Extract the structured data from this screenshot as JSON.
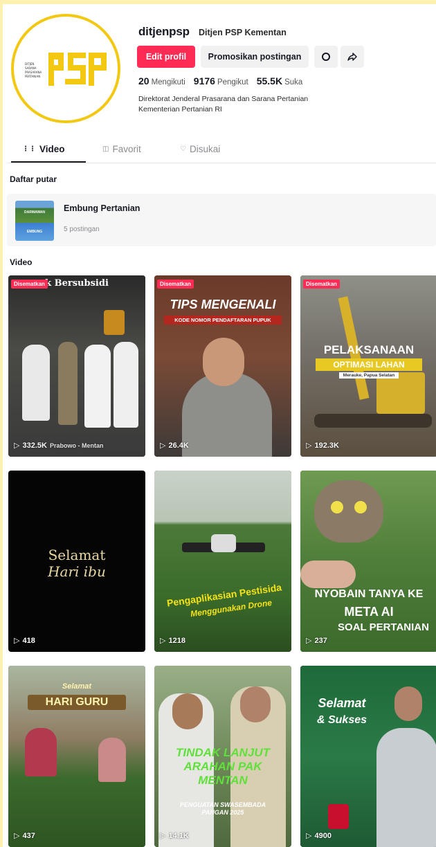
{
  "profile": {
    "username": "ditjenpsp",
    "nickname": "Ditjen PSP Kementan",
    "edit_button": "Edit profil",
    "promote_button": "Promosikan postingan",
    "stats": [
      {
        "value": "20",
        "label": "Mengikuti"
      },
      {
        "value": "9176",
        "label": "Pengikut"
      },
      {
        "value": "55.5K",
        "label": "Suka"
      }
    ],
    "bio_line1": "Direktorat Jenderal Prasarana dan Sarana Pertanian",
    "bio_line2": "Kementerian Pertanian RI",
    "avatar_logo_text": "PSP",
    "avatar_color": "#f2c813"
  },
  "tabs": [
    {
      "label": "Video",
      "icon": "grid-icon",
      "active": true
    },
    {
      "label": "Favorit",
      "icon": "bookmark-icon",
      "active": false
    },
    {
      "label": "Disukai",
      "icon": "heart-icon",
      "active": false
    }
  ],
  "playlist_section": {
    "label": "Daftar putar",
    "item": {
      "title": "Embung Pertanian",
      "count": "5 postingan",
      "thumb_text_top": "DARMAWAN",
      "thumb_text_bottom": "EMBUNG"
    }
  },
  "video_section": {
    "label": "Video",
    "pinned_label": "Disematkan",
    "items": [
      {
        "views": "332.5K",
        "pinned": true,
        "overlay": "Prabowo - Mentan",
        "top_text": "k Bersubsidi"
      },
      {
        "views": "26.4K",
        "pinned": true,
        "overlay": "TIPS MENGENALI",
        "sub": "KODE NOMOR PENDAFTARAN PUPUK"
      },
      {
        "views": "192.3K",
        "pinned": true,
        "overlay": "PELAKSANAAN",
        "sub": "OPTIMASI LAHAN",
        "sub2": "Merauke, Papua Selatan"
      },
      {
        "views": "418",
        "pinned": false,
        "overlay": "Selamat",
        "sub": "Hari ibu"
      },
      {
        "views": "1218",
        "pinned": false,
        "overlay": "Pengaplikasian Pestisida",
        "sub": "Menggunakan Drone"
      },
      {
        "views": "237",
        "pinned": false,
        "overlay": "NYOBAIN TANYA KE",
        "sub": "META AI",
        "sub2": "SOAL PERTANIAN"
      },
      {
        "views": "437",
        "pinned": false,
        "overlay": "Selamat",
        "sub": "HARI GURU"
      },
      {
        "views": "14.1K",
        "pinned": false,
        "overlay": "TINDAK LANJUT ARAHAN PAK MENTAN",
        "sub": "PENGUATAN SWASEMBADA PANGAN 2025"
      },
      {
        "views": "4900",
        "pinned": false,
        "overlay": "Selamat",
        "sub": "& Sukses"
      }
    ]
  },
  "colors": {
    "accent": "#fe2c55",
    "brand_yellow": "#f2c813",
    "outer_bg": "#fdf0b0"
  }
}
